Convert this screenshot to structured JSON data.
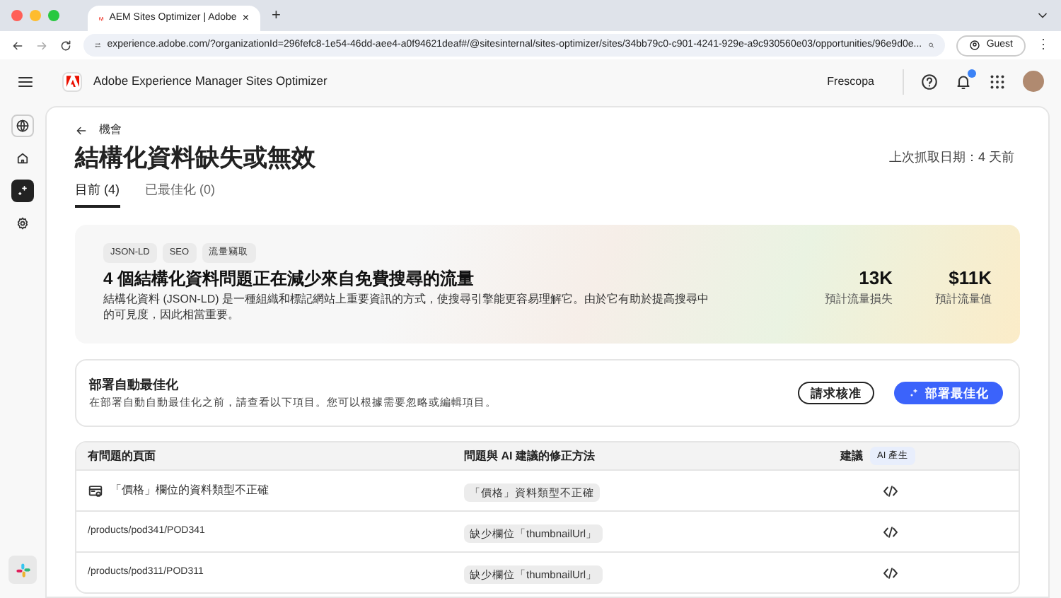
{
  "browser": {
    "tab_title": "AEM Sites Optimizer | Adobe",
    "url": "experience.adobe.com/?organizationId=296fefc8-1e54-46dd-aee4-a0f94621deaf#/@sitesinternal/sites-optimizer/sites/34bb79c0-c901-4241-929e-a9c930560e03/opportunities/96e9d0e...",
    "profile": "Guest",
    "tab_close": "×",
    "new_tab": "+",
    "menu": "⋮"
  },
  "app": {
    "title": "Adobe Experience Manager Sites Optimizer",
    "org": "Frescopa",
    "notification_dot": true
  },
  "sidebar": {
    "items": [
      {
        "selected": false
      },
      {
        "selected": false
      },
      {
        "selected": true
      },
      {
        "selected": false
      }
    ]
  },
  "page": {
    "back_label": "機會",
    "title": "結構化資料缺失或無效",
    "last_fetched": "上次抓取日期：4 天前",
    "tabs": [
      {
        "label": "目前 (4)",
        "selected": true
      },
      {
        "label": "已最佳化 (0)",
        "selected": false
      }
    ]
  },
  "hero": {
    "tags": [
      "JSON-LD",
      "SEO",
      "流量竊取"
    ],
    "headline": "4 個結構化資料問題正在減少來自免費搜尋的流量",
    "description": "結構化資料 (JSON-LD) 是一種組織和標記網站上重要資訊的方式，使搜尋引擎能更容易理解它。由於它有助於提高搜尋中的可見度，因此相當重要。",
    "metrics": [
      {
        "value": "13K",
        "label": "預計流量損失"
      },
      {
        "value": "$11K",
        "label": "預計流量值"
      }
    ]
  },
  "deploy": {
    "title": "部署自動最佳化",
    "description": "在部署自動自動最佳化之前，請查看以下項目。您可以根據需要忽略或編輯項目。",
    "buttons": [
      {
        "label": "請求核准",
        "kind": "outline"
      },
      {
        "label": "部署最佳化",
        "kind": "primary"
      }
    ]
  },
  "table": {
    "columns": [
      "有問題的頁面",
      "問題與 AI 建議的修正方法",
      "建議"
    ],
    "ai_badge": "AI 產生",
    "rows": [
      {
        "kind": "group",
        "page": "「價格」欄位的資料類型不正確",
        "issue": "「價格」資料類型不正確"
      },
      {
        "kind": "page",
        "page": "/products/pod341/POD341",
        "issue": "缺少欄位「thumbnailUrl」"
      },
      {
        "kind": "page",
        "page": "/products/pod311/POD311",
        "issue": "缺少欄位「thumbnailUrl」"
      }
    ]
  }
}
